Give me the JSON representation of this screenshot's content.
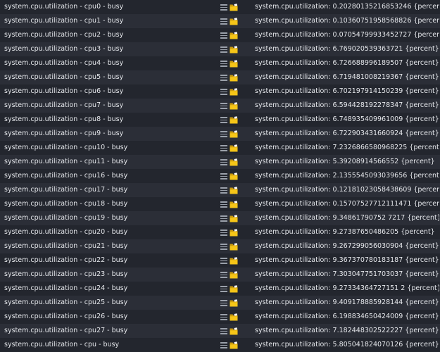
{
  "colors": {
    "folder": "#f5c518",
    "folder_dark": "#c99a0e"
  },
  "rows": [
    {
      "name": "system.cpu.utilization - cpu0 - busy",
      "value": "system.cpu.utilization: 0.20280135216853246 {percent}"
    },
    {
      "name": "system.cpu.utilization - cpu1 - busy",
      "value": "system.cpu.utilization: 0.10360751958568826 {percent}"
    },
    {
      "name": "system.cpu.utilization - cpu2 - busy",
      "value": "system.cpu.utilization: 0.07054799933452727 {percent}"
    },
    {
      "name": "system.cpu.utilization - cpu3 - busy",
      "value": "system.cpu.utilization: 6.769020539363721 {percent}"
    },
    {
      "name": "system.cpu.utilization - cpu4 - busy",
      "value": "system.cpu.utilization: 6.726688996189507 {percent}"
    },
    {
      "name": "system.cpu.utilization - cpu5 - busy",
      "value": "system.cpu.utilization: 6.719481008219367 {percent}"
    },
    {
      "name": "system.cpu.utilization - cpu6 - busy",
      "value": "system.cpu.utilization: 6.702197914150239 {percent}"
    },
    {
      "name": "system.cpu.utilization - cpu7 - busy",
      "value": "system.cpu.utilization: 6.594428192278347 {percent}"
    },
    {
      "name": "system.cpu.utilization - cpu8 - busy",
      "value": "system.cpu.utilization: 6.748935409961009 {percent}"
    },
    {
      "name": "system.cpu.utilization - cpu9 - busy",
      "value": "system.cpu.utilization: 6.722903431660924 {percent}"
    },
    {
      "name": "system.cpu.utilization - cpu10 - busy",
      "value": "system.cpu.utilization: 7.2326866580968225 {percent}"
    },
    {
      "name": "system.cpu.utilization - cpu11 - busy",
      "value": "system.cpu.utilization: 5.39208914566552 {percent}"
    },
    {
      "name": "system.cpu.utilization - cpu16 - busy",
      "value": "system.cpu.utilization: 2.1355545093039656 {percent}"
    },
    {
      "name": "system.cpu.utilization - cpu17 - busy",
      "value": "system.cpu.utilization: 0.12181023058438609 {percent}"
    },
    {
      "name": "system.cpu.utilization - cpu18 - busy",
      "value": "system.cpu.utilization: 0.15707527712111471 {percent}"
    },
    {
      "name": "system.cpu.utilization - cpu19 - busy",
      "value": "system.cpu.utilization: 9.34861790752 7217 {percent}"
    },
    {
      "name": "system.cpu.utilization - cpu20 - busy",
      "value": "system.cpu.utilization: 9.27387650486205 {percent}"
    },
    {
      "name": "system.cpu.utilization - cpu21 - busy",
      "value": "system.cpu.utilization: 9.267299056030904 {percent}"
    },
    {
      "name": "system.cpu.utilization - cpu22 - busy",
      "value": "system.cpu.utilization: 9.367370780183187 {percent}"
    },
    {
      "name": "system.cpu.utilization - cpu23 - busy",
      "value": "system.cpu.utilization: 7.303047751703037 {percent}"
    },
    {
      "name": "system.cpu.utilization - cpu24 - busy",
      "value": "system.cpu.utilization: 9.27334364727151 2 {percent}"
    },
    {
      "name": "system.cpu.utilization - cpu25 - busy",
      "value": "system.cpu.utilization: 9.409178885928144 {percent}"
    },
    {
      "name": "system.cpu.utilization - cpu26 - busy",
      "value": "system.cpu.utilization: 6.198834650424009 {percent}"
    },
    {
      "name": "system.cpu.utilization - cpu27 - busy",
      "value": "system.cpu.utilization: 7.182448302522227 {percent}"
    },
    {
      "name": "system.cpu.utilization - cpu - busy",
      "value": "system.cpu.utilization: 5.805041824070126 {percent}"
    }
  ]
}
